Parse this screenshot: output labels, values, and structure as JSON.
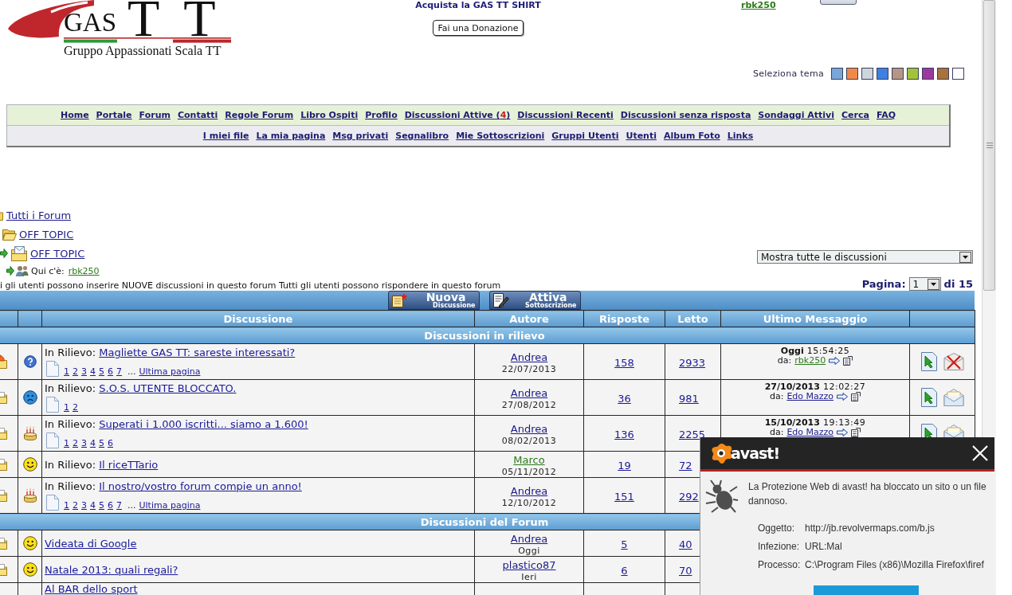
{
  "logo": {
    "acronym": "GAS",
    "letters": "TT",
    "tagline": "Gruppo Appassionati Scala TT"
  },
  "header": {
    "shirt_link": "Acquista la GAS TT SHIRT",
    "donate_button": "Fai una Donazione",
    "user_link": "rbk250"
  },
  "theme_selector": {
    "label": "Seleziona tema",
    "themes": [
      {
        "color": "#7aa6d8"
      },
      {
        "color": "#f0884a"
      },
      {
        "color": "#cdd5dd"
      },
      {
        "color": "#3f80e2"
      },
      {
        "color": "#b49686"
      },
      {
        "color": "#a2c23a"
      },
      {
        "color": "#9c389e"
      },
      {
        "color": "#a8723c"
      },
      {
        "color": "#ffffff"
      }
    ]
  },
  "nav": {
    "primary": [
      {
        "label": "Home"
      },
      {
        "label": "Portale"
      },
      {
        "label": "Forum"
      },
      {
        "label": "Contatti"
      },
      {
        "label": "Regole Forum"
      },
      {
        "label": "Libro Ospiti"
      },
      {
        "label": "Profilo"
      },
      {
        "label": "Discussioni Attive (",
        "count": "4",
        "label_end": ")"
      },
      {
        "label": "Discussioni Recenti"
      },
      {
        "label": "Discussioni senza risposta"
      },
      {
        "label": "Sondaggi Attivi"
      },
      {
        "label": "Cerca"
      },
      {
        "label": "FAQ"
      }
    ],
    "secondary": [
      {
        "label": "I miei file"
      },
      {
        "label": "La mia pagina"
      },
      {
        "label": "Msg privati"
      },
      {
        "label": "Segnalibro"
      },
      {
        "label": "Mie Sottoscrizioni"
      },
      {
        "label": "Gruppi Utenti"
      },
      {
        "label": "Utenti"
      },
      {
        "label": "Album Foto"
      },
      {
        "label": "Links"
      }
    ]
  },
  "breadcrumbs": [
    {
      "label": "Tutti i Forum",
      "kind": "root",
      "children": [
        {
          "label": "OFF TOPIC",
          "kind": "folder",
          "children": [
            {
              "label": "OFF TOPIC",
              "kind": "forum"
            }
          ]
        }
      ]
    }
  ],
  "viewers": {
    "label": "Qui c'è:",
    "users": [
      "rbk250"
    ]
  },
  "filter": {
    "value": "Mostra tutte le discussioni"
  },
  "permissions": "i gli utenti possono inserire NUOVE discussioni in questo forum Tutti gli utenti possono rispondere in questo forum",
  "pagination": {
    "label": "Pagina:",
    "value": "1",
    "total": "di 15"
  },
  "toolbar": [
    {
      "kind": "new",
      "title": "Nuova",
      "subtitle": "Discussione"
    },
    {
      "kind": "subscribe",
      "title": "Attiva",
      "subtitle": "Sottoscrizione"
    }
  ],
  "table": {
    "columns": [
      "Discussione",
      "Autore",
      "Risposte",
      "Letto",
      "Ultimo Messaggio"
    ],
    "sections": [
      {
        "title": "Discussioni in rilievo",
        "rows": [
          {
            "status": {
              "kind": "hot"
            },
            "mood": {
              "kind": "question"
            },
            "prefix": "In Rilievo:",
            "title": "Magliette GAS TT: sareste interessati?",
            "pages": [
              "1",
              "2",
              "3",
              "4",
              "5",
              "6",
              "7"
            ],
            "more": "...",
            "last_page": "Ultima pagina",
            "author": {
              "name": "Andrea",
              "color": "#1c1c8c",
              "date": "22/07/2013"
            },
            "replies": "158",
            "reads": "2933",
            "last": {
              "date": "Oggi",
              "time": "15:54:25",
              "by_label": "da:",
              "by": {
                "name": "rbk250",
                "color": "#2b7a1b"
              }
            },
            "subscribed": true
          },
          {
            "status": {
              "kind": "normal"
            },
            "mood": {
              "kind": "sad"
            },
            "prefix": "In Rilievo:",
            "title": "S.O.S. UTENTE BLOCCATO.",
            "pages": [
              "1",
              "2"
            ],
            "author": {
              "name": "Andrea",
              "color": "#1c1c8c",
              "date": "27/08/2012"
            },
            "replies": "36",
            "reads": "981",
            "last": {
              "date": "27/10/2013",
              "time": "12:02:27",
              "by_label": "da:",
              "by": {
                "name": "Edo Mazzo",
                "color": "#1c1c8c"
              }
            },
            "subscribed": false
          },
          {
            "status": {
              "kind": "normal"
            },
            "mood": {
              "kind": "cake"
            },
            "prefix": "In Rilievo:",
            "title": "Superati i 1.000 iscritti... siamo a 1.600!",
            "pages": [
              "1",
              "2",
              "3",
              "4",
              "5",
              "6"
            ],
            "author": {
              "name": "Andrea",
              "color": "#1c1c8c",
              "date": "08/02/2013"
            },
            "replies": "136",
            "reads": "2255",
            "last": {
              "date": "15/10/2013",
              "time": "19:13:49",
              "by_label": "da:",
              "by": {
                "name": "Edo Mazzo",
                "color": "#1c1c8c"
              }
            },
            "subscribed": false
          },
          {
            "status": {
              "kind": "normal"
            },
            "mood": {
              "kind": "smile"
            },
            "prefix": "In Rilievo:",
            "title": "Il riceTTario",
            "author": {
              "name": "Marco",
              "color": "#2b7a1b",
              "date": "05/11/2012"
            },
            "replies": "19",
            "reads": "72"
          },
          {
            "status": {
              "kind": "normal"
            },
            "mood": {
              "kind": "cake"
            },
            "prefix": "In Rilievo:",
            "title": "Il nostro/vostro forum compie un anno!",
            "pages": [
              "1",
              "2",
              "3",
              "4",
              "5",
              "6",
              "7"
            ],
            "more": "...",
            "last_page": "Ultima pagina",
            "author": {
              "name": "Andrea",
              "color": "#1c1c8c",
              "date": "12/10/2012"
            },
            "replies": "151",
            "reads": "292"
          }
        ]
      },
      {
        "title": "Discussioni del Forum",
        "rows": [
          {
            "status": {
              "kind": "normal"
            },
            "mood": {
              "kind": "smile"
            },
            "title": "Videata di Google",
            "author": {
              "name": "Andrea",
              "color": "#1c1c8c",
              "date": "Oggi"
            },
            "replies": "5",
            "reads": "40"
          },
          {
            "status": {
              "kind": "normal"
            },
            "mood": {
              "kind": "smile"
            },
            "title": "Natale 2013: quali regali?",
            "author": {
              "name": "plastico87",
              "color": "#1c1c8c",
              "date": "Ieri"
            },
            "replies": "6",
            "reads": "70"
          },
          {
            "status": {
              "kind": "normal"
            },
            "title": "Al BAR dello sport"
          }
        ]
      }
    ]
  },
  "popup": {
    "brand": "avast!",
    "message": "La Protezione Web di avast! ha bloccato un sito o un file dannoso.",
    "details": [
      {
        "label": "Oggetto:",
        "value": "http://jb.revolvermaps.com/b.js"
      },
      {
        "label": "Infezione:",
        "value": "URL:Mal"
      },
      {
        "label": "Processo:",
        "value": "C:\\Program Files (x86)\\Mozilla Firefox\\firef"
      }
    ]
  }
}
